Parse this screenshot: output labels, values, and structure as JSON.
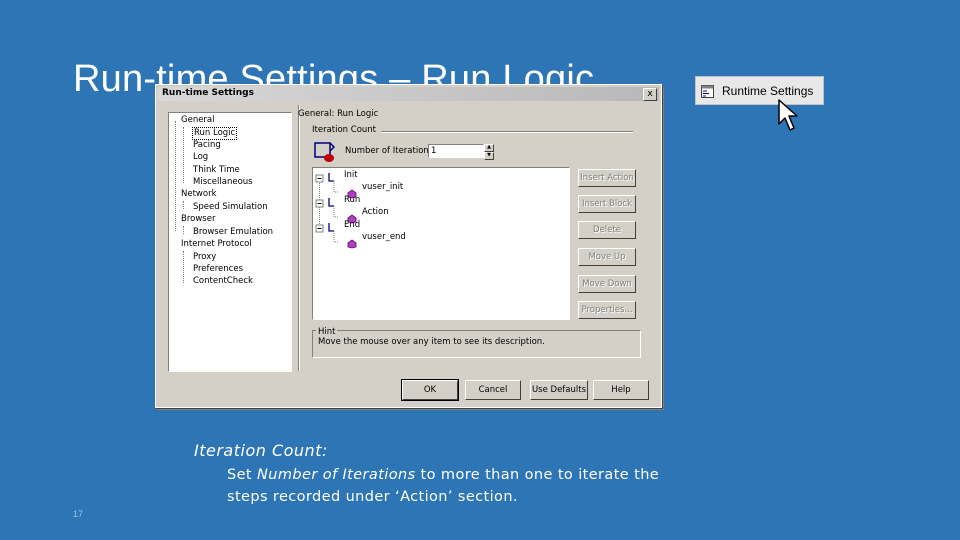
{
  "slide": {
    "title": "Run-time Settings – Run Logic",
    "page_number": "17"
  },
  "dialog": {
    "title": "Run-time Settings",
    "close_label": "x",
    "tree": [
      {
        "label": "General"
      },
      {
        "label": "Run Logic",
        "selected": true
      },
      {
        "label": "Pacing"
      },
      {
        "label": "Log"
      },
      {
        "label": "Think Time"
      },
      {
        "label": "Miscellaneous"
      },
      {
        "label": "Network"
      },
      {
        "label": "Speed Simulation"
      },
      {
        "label": "Browser"
      },
      {
        "label": "Browser Emulation"
      },
      {
        "label": "Internet Protocol"
      },
      {
        "label": "Proxy"
      },
      {
        "label": "Preferences"
      },
      {
        "label": "ContentCheck"
      }
    ],
    "section_title": "General: Run Logic",
    "iteration_group_label": "Iteration Count",
    "iterations_label": "Number of Iterations:",
    "iterations_value": "1",
    "flow": [
      {
        "label": "Init"
      },
      {
        "label": "vuser_init"
      },
      {
        "label": "Run"
      },
      {
        "label": "Action"
      },
      {
        "label": "End"
      },
      {
        "label": "vuser_end"
      }
    ],
    "action_buttons": {
      "insert_action": "Insert Action",
      "insert_block": "Insert Block",
      "delete": "Delete",
      "move_up": "Move Up",
      "move_down": "Move Down",
      "properties": "Properties..."
    },
    "hint": {
      "label": "Hint",
      "text": "Move the mouse over any item to see its description."
    },
    "footer_buttons": {
      "ok": "OK",
      "cancel": "Cancel",
      "use_defaults": "Use Defaults",
      "help": "Help"
    }
  },
  "runtime_button": {
    "label": "Runtime Settings",
    "icon": "runtime-settings-icon"
  },
  "caption": {
    "heading": "Iteration Count:",
    "line1_pre": "Set ",
    "line1_em": "Number of Iterations",
    "line1_post": " to more than one to iterate the",
    "line2": "steps recorded under ‘Action’ section."
  },
  "colors": {
    "slide_background": "#2e75b6",
    "dialog_face": "#d4d0c8",
    "selection_tree_item": "#ffffff"
  }
}
